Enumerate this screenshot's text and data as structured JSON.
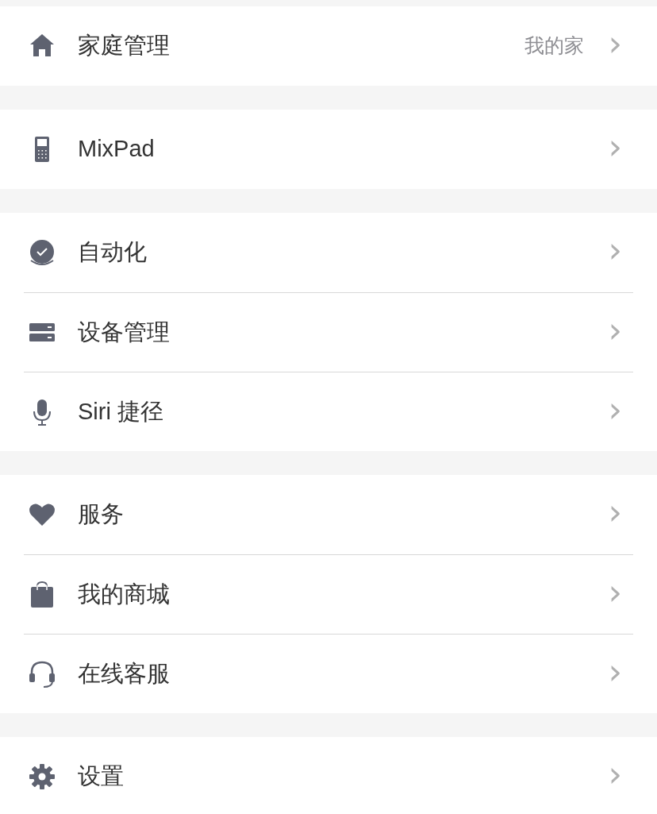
{
  "groups": [
    {
      "items": [
        {
          "label": "家庭管理",
          "value": "我的家",
          "chevron": "›"
        }
      ]
    },
    {
      "items": [
        {
          "label": "MixPad",
          "chevron": "›"
        }
      ]
    },
    {
      "items": [
        {
          "label": "自动化",
          "chevron": "›"
        },
        {
          "label": "设备管理",
          "chevron": "›"
        },
        {
          "label": "Siri 捷径",
          "chevron": "›"
        }
      ]
    },
    {
      "items": [
        {
          "label": "服务",
          "chevron": "›"
        },
        {
          "label": "我的商城",
          "chevron": "›"
        },
        {
          "label": "在线客服",
          "chevron": "›"
        }
      ]
    },
    {
      "items": [
        {
          "label": "设置",
          "chevron": "›"
        }
      ]
    }
  ]
}
